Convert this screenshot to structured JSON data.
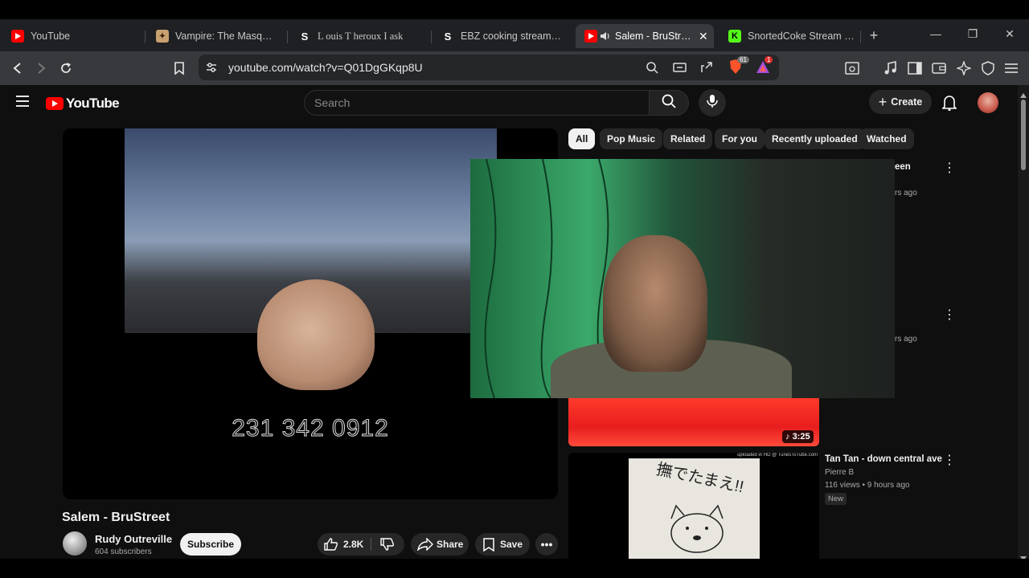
{
  "browser": {
    "tabs": [
      {
        "label": "YouTube",
        "favicon": "youtube-icon"
      },
      {
        "label": "Vampire: The Masquerade",
        "favicon": "game-icon"
      },
      {
        "label": "L ouis T heroux I ask",
        "favicon": "s-site-icon"
      },
      {
        "label": "EBZ cooking streams are",
        "favicon": "s-site-icon"
      },
      {
        "label": "Salem - BruStreet",
        "favicon": "youtube-icon"
      },
      {
        "label": "SnortedCoke Stream - V",
        "favicon": "kick-icon"
      }
    ],
    "url": "youtube.com/watch?v=Q01DgGKqp8U",
    "brave_badge": "61",
    "rewards_badge": "1"
  },
  "youtube": {
    "logo_text": "YouTube",
    "search_placeholder": "Search",
    "create_label": "Create",
    "chips": [
      "All",
      "Pop Music",
      "Related",
      "For you",
      "Recently uploaded",
      "Watched"
    ],
    "player": {
      "overlay_text": "231 342 0912"
    },
    "video": {
      "title": "Salem - BruStreet",
      "channel": "Rudy Outreville",
      "subscribers": "604 subscribers",
      "subscribe_label": "Subscribe",
      "likes": "2.8K",
      "share_label": "Share",
      "save_label": "Save"
    },
    "recommendations": [
      {
        "title_fragment": "een",
        "meta_fragment": "rs ago"
      },
      {
        "meta_fragment": "rs ago"
      },
      {
        "duration": "3:25"
      },
      {
        "thumb_caption": "uploaded in HD @ TunesToTube.com",
        "thumb_text": "撫でたまえ!!",
        "title": "Tan Tan - down central ave",
        "channel": "Pierre B",
        "meta": "116 views • 9 hours ago",
        "tag": "New"
      }
    ]
  },
  "colors": {
    "youtube_red": "#ff0000",
    "kick_green": "#53fc18"
  }
}
